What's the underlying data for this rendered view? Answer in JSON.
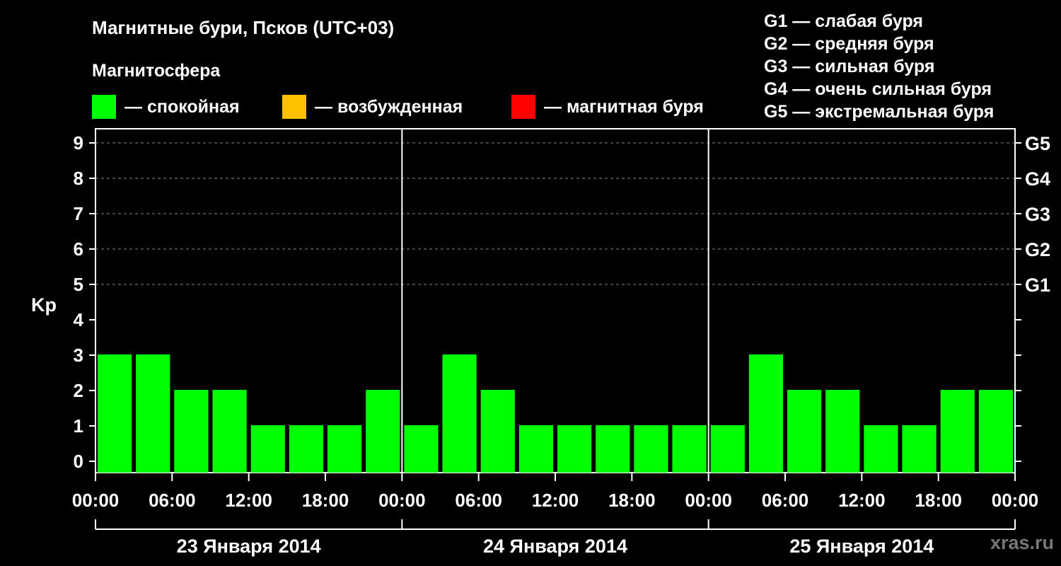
{
  "header": {
    "title": "Магнитные бури, Псков (UTC+03)",
    "subtitle": "Магнитосфера"
  },
  "legend": [
    {
      "label": "— спокойная",
      "color": "#00ff00"
    },
    {
      "label": "— возбужденная",
      "color": "#ffc000"
    },
    {
      "label": "— магнитная буря",
      "color": "#ff0000"
    }
  ],
  "g_scale": [
    "G1 — слабая буря",
    "G2 — средняя буря",
    "G3 — сильная буря",
    "G4 — очень сильная буря",
    "G5 — экстремальная буря"
  ],
  "brand": "xras.ru",
  "chart_data": {
    "type": "bar",
    "ylabel": "Kp",
    "ylim": [
      0,
      9
    ],
    "yticks": [
      "0",
      "1",
      "2",
      "3",
      "4",
      "5",
      "6",
      "7",
      "8",
      "9"
    ],
    "right_axis_labels": [
      {
        "kp": 5,
        "label": "G1"
      },
      {
        "kp": 6,
        "label": "G2"
      },
      {
        "kp": 7,
        "label": "G3"
      },
      {
        "kp": 8,
        "label": "G4"
      },
      {
        "kp": 9,
        "label": "G5"
      }
    ],
    "xtick_labels": [
      "00:00",
      "06:00",
      "12:00",
      "18:00",
      "00:00",
      "06:00",
      "12:00",
      "18:00",
      "00:00",
      "06:00",
      "12:00",
      "18:00",
      "00:00"
    ],
    "days": [
      "23 Января 2014",
      "24 Января 2014",
      "25 Января 2014"
    ],
    "grid": true,
    "values": [
      3,
      3,
      2,
      2,
      1,
      1,
      1,
      2,
      1,
      3,
      2,
      1,
      1,
      1,
      1,
      1,
      1,
      3,
      2,
      2,
      1,
      1,
      2,
      2
    ],
    "bar_color": "#00ff00"
  }
}
